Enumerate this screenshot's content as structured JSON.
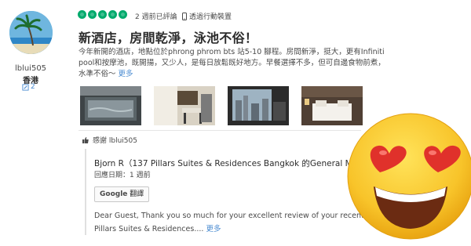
{
  "reviewer": {
    "name": "lblui505",
    "location": "香港",
    "contributions": "2"
  },
  "review": {
    "rating": 5,
    "date": "2 週前已評論",
    "via": "透過行動裝置",
    "title": "新酒店，房間乾淨，泳池不俗！",
    "body": "今年新開的酒店，地點位於phrong phrom bts 站5-10 腳程。房間新淨，挺大，更有Infiniti pool和按摩池，既開揚，又少人，是每日放鬆既好地方。早餐選擇不多，但可自邊食物前煮，水準不俗～",
    "more": "更多",
    "thank": "感謝 lblui505"
  },
  "response": {
    "name": "Bjorn R（137 Pillars Suites & Residences Bangkok 的General Manager）",
    "date": "回應日期：1 週前",
    "google_label": "Google",
    "translate_label": "翻譯",
    "reply_line1": "Dear Guest, Thank you so much for your excellent review of your recent visit",
    "reply_line2": "Pillars Suites & Residences....",
    "more": "更多"
  },
  "colors": {
    "bubble": "#00aa6c",
    "link": "#4a8bd1",
    "emoji_face": "#f7c22f",
    "emoji_heart": "#e0312b"
  },
  "icons": {
    "mobile": "phone-icon",
    "thank": "thumbs-up-icon",
    "contrib": "pencil-icon",
    "overlay": "heart-eyes-emoji"
  }
}
